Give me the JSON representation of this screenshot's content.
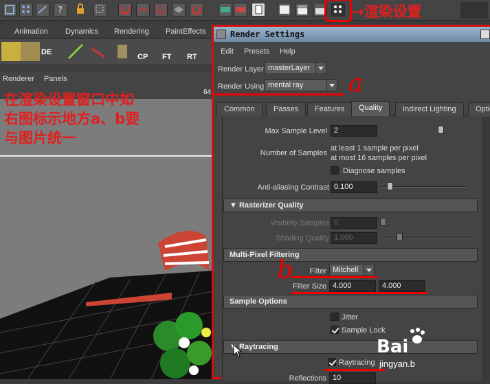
{
  "annotations": {
    "render_settings_label": "→渲染设置",
    "instruction": [
      "在渲染设置窗口中如",
      "右图标示地方a、b要",
      "与图片统一"
    ],
    "mark_a": "a",
    "mark_b": "b"
  },
  "shelf": {
    "tabs": [
      "Animation",
      "Dynamics",
      "Rendering",
      "PaintEffects"
    ],
    "icons": [
      "DE",
      "CP",
      "FT",
      "RT"
    ]
  },
  "panel_menu": {
    "renderer": "Renderer",
    "panels": "Panels",
    "frame_num": "64"
  },
  "render_settings": {
    "title": "Render Settings",
    "menu": [
      "Edit",
      "Presets",
      "Help"
    ],
    "render_layer_label": "Render Layer",
    "render_layer_value": "masterLayer",
    "render_using_label": "Render Using",
    "render_using_value": "mental ray",
    "tabs": [
      "Common",
      "Passes",
      "Features",
      "Quality",
      "Indirect Lighting",
      "Optio"
    ],
    "active_tab": "Quality",
    "max_sample_level_label": "Max Sample Level",
    "max_sample_level_value": "2",
    "num_samples_label": "Number of Samples",
    "num_samples_line1": "at least 1 sample per pixel",
    "num_samples_line2": "at most 16 samples per pixel",
    "diagnose_label": "Diagnose samples",
    "aa_contrast_label": "Anti-aliasing Contrast",
    "aa_contrast_value": "0.100",
    "rasterizer_title": "Rasterizer Quality",
    "visibility_label": "Visibility Samples",
    "visibility_value": "0",
    "shading_label": "Shading Quality",
    "shading_value": "1.000",
    "mpf_title": "Multi-Pixel Filtering",
    "filter_label": "Filter",
    "filter_value": "Mitchell",
    "filter_size_label": "Filter Size",
    "filter_size_x": "4.000",
    "filter_size_y": "4.000",
    "sample_options_title": "Sample Options",
    "jitter_label": "Jitter",
    "sample_lock_label": "Sample Lock",
    "raytracing_title": "Raytracing",
    "raytracing_label": "Raytracing",
    "reflections_label": "Reflections",
    "reflections_value": "10"
  },
  "watermark": {
    "logo": "Bai",
    "site": "jingyan.b"
  },
  "colors": {
    "annotation_red": "#e02020",
    "title_bar": "#7e9ab4"
  }
}
